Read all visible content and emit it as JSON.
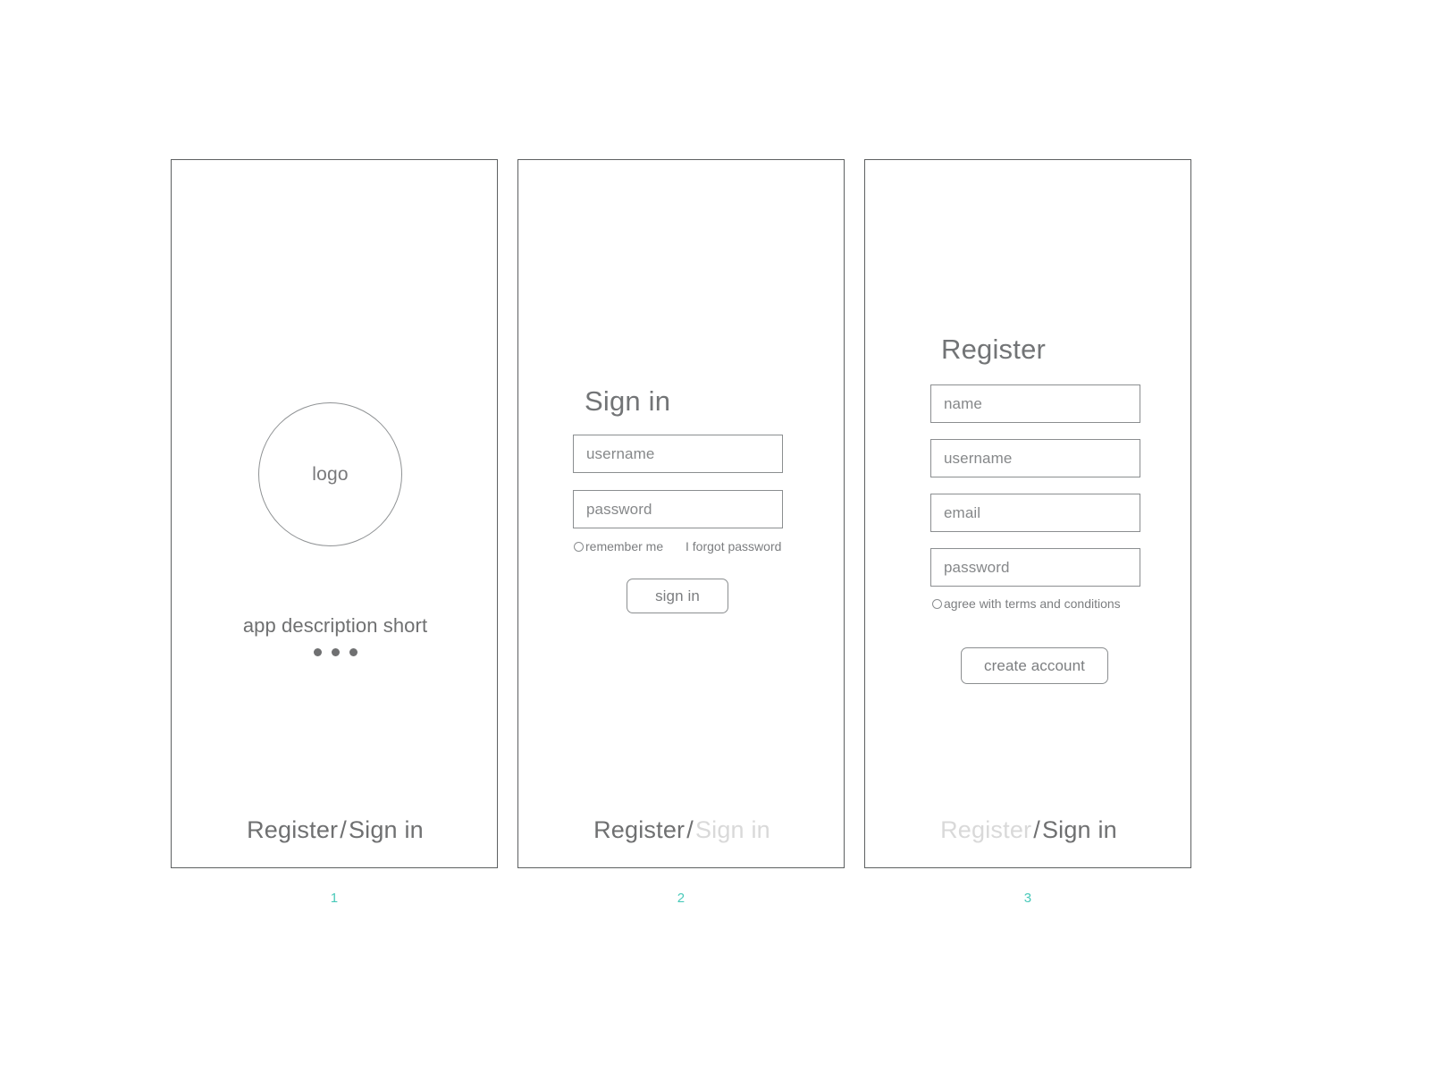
{
  "screens": [
    {
      "index_label": "1",
      "name": "splash",
      "logo_text": "logo",
      "app_description": "app description short",
      "dot_count": 3,
      "bottom_nav": {
        "register_label": "Register",
        "separator": "/",
        "signin_label": "Sign in",
        "register_active": true,
        "signin_active": true
      }
    },
    {
      "index_label": "2",
      "name": "sign-in",
      "heading": "Sign in",
      "fields": [
        {
          "key": "username",
          "placeholder": "username"
        },
        {
          "key": "password",
          "placeholder": "password"
        }
      ],
      "remember_me_label": "remember me",
      "forgot_password_label": "I forgot password",
      "submit_label": "sign in",
      "bottom_nav": {
        "register_label": "Register",
        "separator": "/",
        "signin_label": "Sign in",
        "register_active": true,
        "signin_active": false
      }
    },
    {
      "index_label": "3",
      "name": "register",
      "heading": "Register",
      "fields": [
        {
          "key": "name",
          "placeholder": "name"
        },
        {
          "key": "username",
          "placeholder": "username"
        },
        {
          "key": "email",
          "placeholder": "email"
        },
        {
          "key": "password",
          "placeholder": "password"
        }
      ],
      "terms_label": "agree with terms and conditions",
      "submit_label": "create account",
      "bottom_nav": {
        "register_label": "Register",
        "separator": "/",
        "signin_label": "Sign in",
        "register_active": false,
        "signin_active": true
      }
    }
  ],
  "colors": {
    "page_number": "#48c9b9",
    "screen_border": "#5d6061",
    "text": "#6f7071",
    "text_muted": "#86888a",
    "text_disabled": "#d9d9d9",
    "field_border": "#8b8e90",
    "background": "#ffffff"
  }
}
